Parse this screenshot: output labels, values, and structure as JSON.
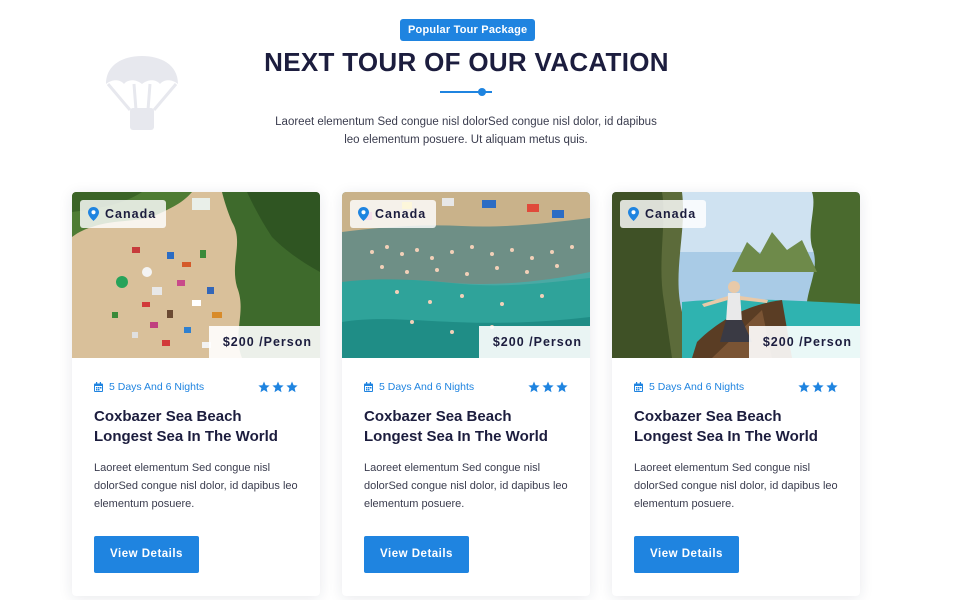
{
  "section": {
    "badge": "Popular Tour Package",
    "title": "NEXT TOUR OF OUR VACATION",
    "description": "Laoreet elementum Sed congue nisl dolorSed congue nisl dolor, id dapibus leo elementum posuere. Ut aliquam metus quis.",
    "decor_icon": "parachute-icon"
  },
  "colors": {
    "accent": "#1f84e0",
    "heading": "#1c1d3e",
    "body_text": "#3a3c4e"
  },
  "tours": [
    {
      "location": "Canada",
      "price": "$200 /Person",
      "duration": "5 Days And 6 Nights",
      "rating": 3,
      "title": "Coxbazer Sea Beach Longest Sea In The World",
      "description": "Laoreet elementum Sed congue nisl dolorSed congue nisl dolor, id dapibus leo elementum posuere.",
      "button_label": "View Details",
      "image": "aerial beach with umbrellas and forest"
    },
    {
      "location": "Canada",
      "price": "$200 /Person",
      "duration": "5 Days And 6 Nights",
      "rating": 3,
      "title": "Coxbazer Sea Beach Longest Sea In The World",
      "description": "Laoreet elementum Sed congue nisl dolorSed congue nisl dolor, id dapibus leo elementum posuere.",
      "button_label": "View Details",
      "image": "aerial crowded beach with swimmers"
    },
    {
      "location": "Canada",
      "price": "$200 /Person",
      "duration": "5 Days And 6 Nights",
      "rating": 3,
      "title": "Coxbazer Sea Beach Longest Sea In The World",
      "description": "Laoreet elementum Sed congue nisl dolorSed congue nisl dolor, id dapibus leo elementum posuere.",
      "button_label": "View Details",
      "image": "woman on boat among limestone cliffs"
    }
  ]
}
